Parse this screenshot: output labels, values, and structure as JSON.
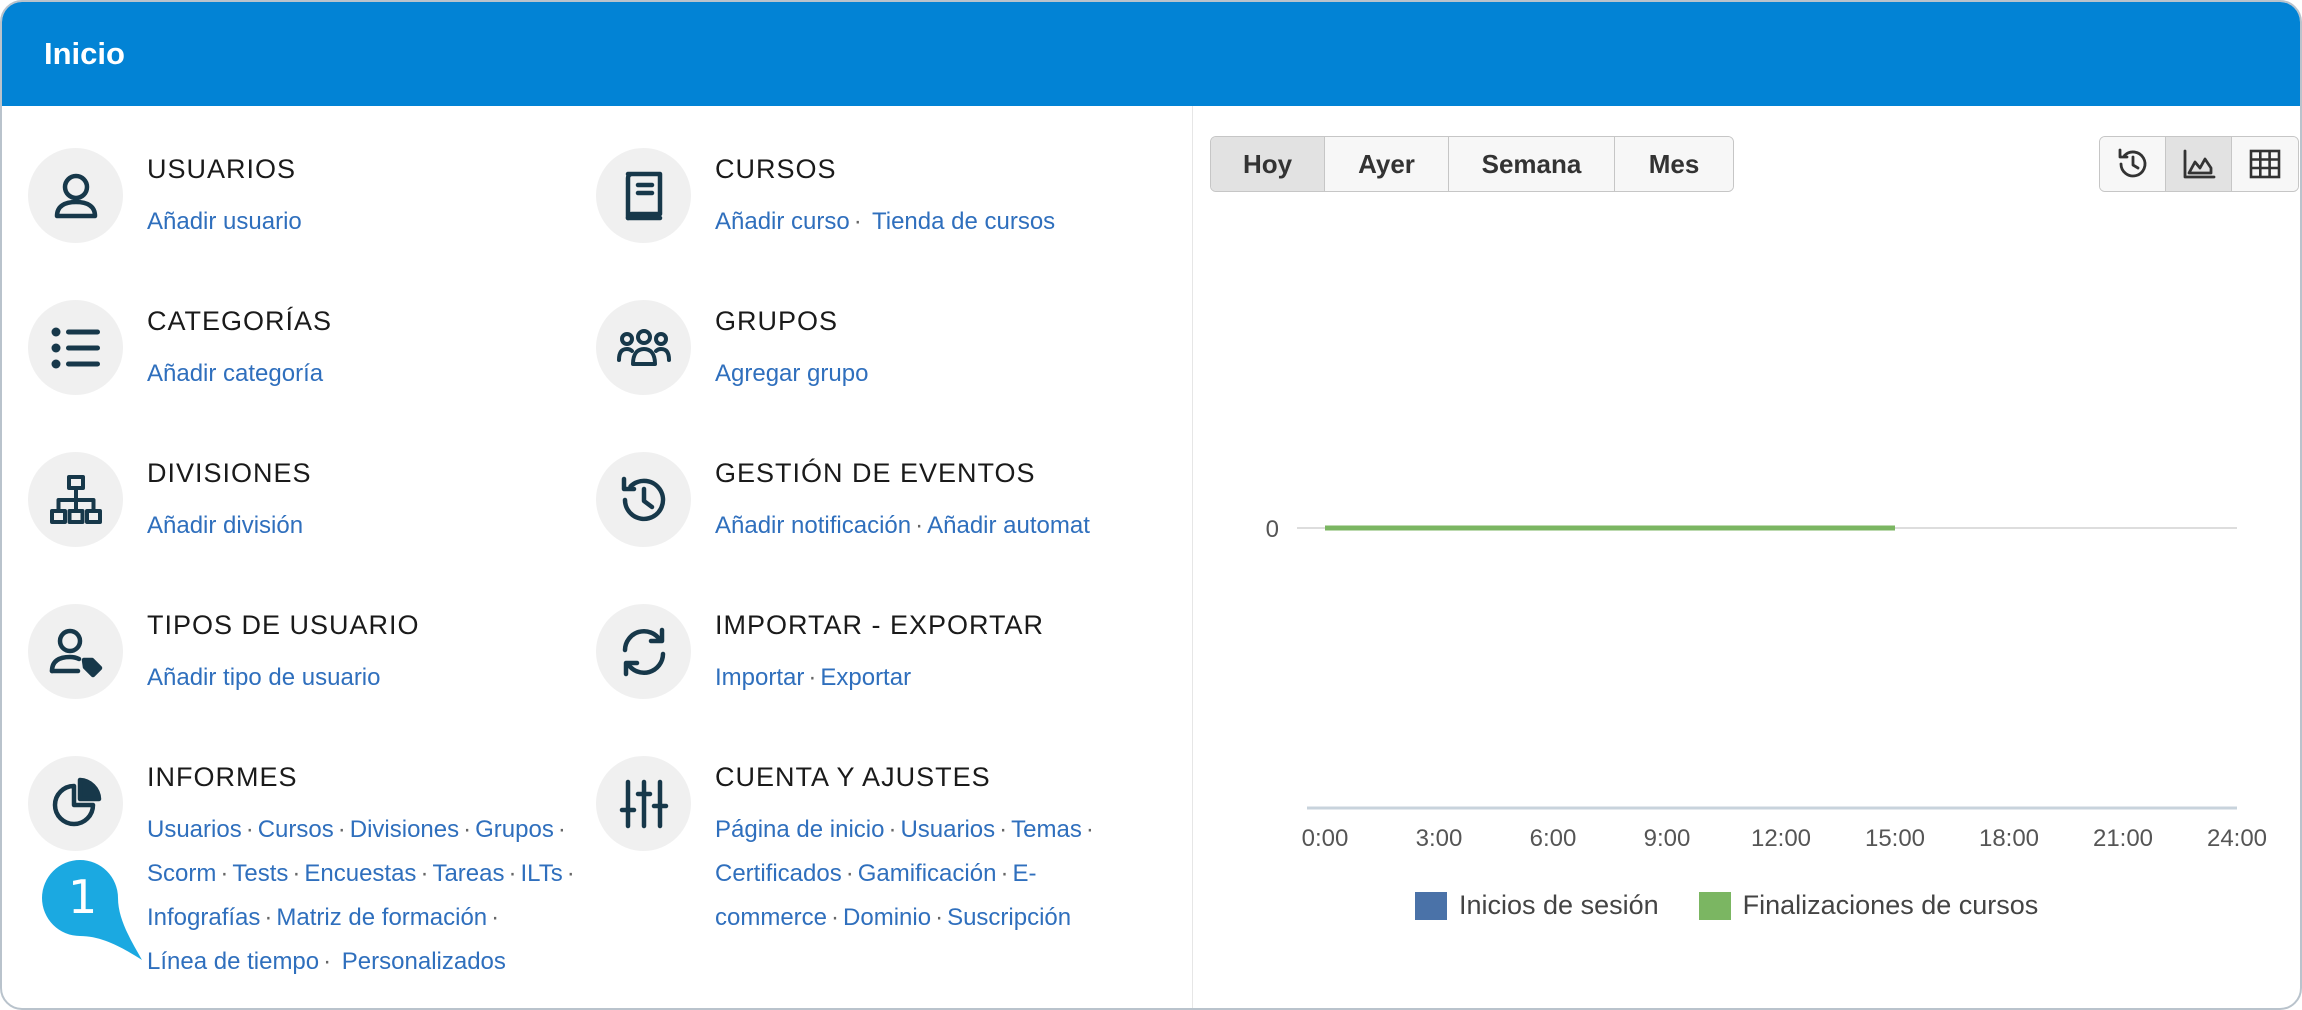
{
  "header": {
    "title": "Inicio"
  },
  "modules": {
    "usuarios": {
      "title": "USUARIOS",
      "links": [
        "Añadir usuario"
      ]
    },
    "cursos": {
      "title": "CURSOS",
      "links": [
        "Añadir curso",
        "Tienda de cursos"
      ]
    },
    "categorias": {
      "title": "CATEGORÍAS",
      "links": [
        "Añadir categoría"
      ]
    },
    "grupos": {
      "title": "GRUPOS",
      "links": [
        "Agregar grupo"
      ]
    },
    "divisiones": {
      "title": "DIVISIONES",
      "links": [
        "Añadir división"
      ]
    },
    "eventos": {
      "title": "GESTIÓN DE EVENTOS",
      "links": [
        "Añadir notificación",
        "Añadir automat"
      ]
    },
    "tipos": {
      "title": "TIPOS DE USUARIO",
      "links": [
        "Añadir tipo de usuario"
      ]
    },
    "importar": {
      "title": "IMPORTAR - EXPORTAR",
      "links": [
        "Importar",
        "Exportar"
      ]
    },
    "informes": {
      "title": "INFORMES",
      "links": [
        "Usuarios",
        "Cursos",
        "Divisiones",
        "Grupos",
        "Scorm",
        "Tests",
        "Encuestas",
        "Tareas",
        "ILTs",
        "Infografías",
        "Matriz de formación",
        "Línea de tiempo",
        "Personalizados"
      ]
    },
    "cuenta": {
      "title": "CUENTA Y AJUSTES",
      "links": [
        "Página de inicio",
        "Usuarios",
        "Temas",
        "Certificados",
        "Gamificación",
        "E-",
        "commerce",
        "Dominio",
        "Suscripción"
      ]
    }
  },
  "separator": "·",
  "period_buttons": [
    "Hoy",
    "Ayer",
    "Semana",
    "Mes"
  ],
  "period_active": "Hoy",
  "view_buttons": [
    "history-icon",
    "area-chart-icon",
    "table-grid-icon"
  ],
  "view_active": "area-chart-icon",
  "callout": {
    "number": "1",
    "color": "#1ba9e1"
  },
  "colors": {
    "header": "#0283d5",
    "link": "#2f6fbd",
    "icon": "#17384a"
  },
  "chart_data": {
    "type": "area",
    "x": [
      "0:00",
      "3:00",
      "6:00",
      "9:00",
      "12:00",
      "15:00",
      "18:00",
      "21:00",
      "24:00"
    ],
    "y_ticks": [
      "0"
    ],
    "series": [
      {
        "name": "Inicios de sesión",
        "color": "#4a72a8",
        "values": [
          0,
          0,
          0,
          0,
          0,
          0
        ]
      },
      {
        "name": "Finalizaciones de cursos",
        "color": "#7bb662",
        "values": [
          0,
          0,
          0,
          0,
          0,
          0
        ]
      }
    ],
    "xlabel": "",
    "ylabel": "",
    "legend": "bottom"
  }
}
